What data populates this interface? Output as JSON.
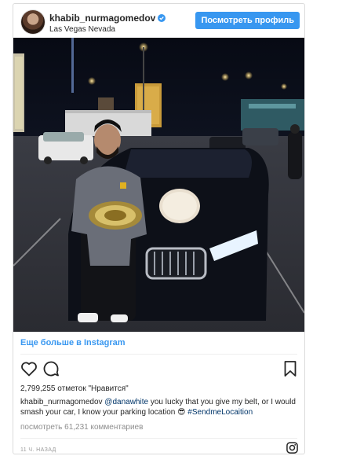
{
  "post": {
    "username": "khabib_nurmagomedov",
    "location": "Las Vegas Nevada",
    "view_profile_label": "Посмотреть профиль",
    "more_link": "Еще больше в Instagram",
    "likes_text": "2,799,255 отметок \"Нравится\"",
    "caption_user": "khabib_nurmagomedov",
    "caption_mention": "@danawhite",
    "caption_text": " you lucky that you give my belt, or I would smash your car, I know your parking location 😎 ",
    "caption_hashtag": "#SendmeLocaition",
    "comments_text": "посмотреть 61,231 комментариев",
    "time_text": "11 Ч. НАЗАД"
  },
  "colors": {
    "accent": "#3897f0",
    "link": "#003569",
    "muted": "#8e8e8e"
  },
  "icons": [
    "verified-badge-icon",
    "heart-icon",
    "comment-icon",
    "bookmark-icon",
    "instagram-logo-icon"
  ]
}
